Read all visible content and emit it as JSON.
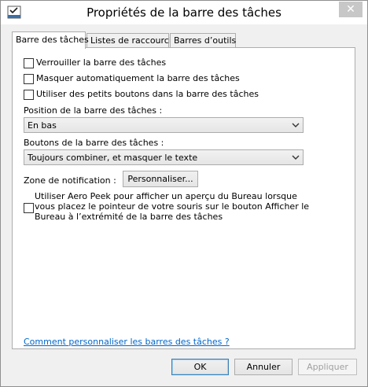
{
  "window": {
    "title": "Propriétés de la barre des tâches",
    "close_glyph": "✕"
  },
  "tabs": [
    {
      "label": "Barre des tâches",
      "active": true
    },
    {
      "label": "Listes de raccourcis",
      "active": false
    },
    {
      "label": "Barres d’outils",
      "active": false
    }
  ],
  "options": {
    "lock_label": "Verrouiller la barre des tâches",
    "autohide_label": "Masquer automatiquement la barre des tâches",
    "small_buttons_label": "Utiliser des petits boutons dans la barre des tâches",
    "lock_checked": false,
    "autohide_checked": false,
    "small_buttons_checked": false
  },
  "position": {
    "label": "Position de la barre des tâches :",
    "value": "En bas"
  },
  "buttons_combine": {
    "label": "Boutons de la barre des tâches :",
    "value": "Toujours combiner, et masquer le texte"
  },
  "notification": {
    "label": "Zone de notification :",
    "button_label": "Personnaliser..."
  },
  "aero_peek": {
    "label": "Utiliser Aero Peek pour afficher un aperçu du Bureau lorsque vous placez le pointeur de votre souris sur le bouton Afficher le Bureau à l’extrémité de la barre des tâches",
    "checked": false
  },
  "help_link": "Comment personnaliser les barres des tâches ?",
  "footer": {
    "ok_label": "OK",
    "cancel_label": "Annuler",
    "apply_label": "Appliquer"
  },
  "colors": {
    "accent": "#3c7fb1",
    "link": "#0066cc",
    "disabled_text": "#a0a0a0"
  }
}
